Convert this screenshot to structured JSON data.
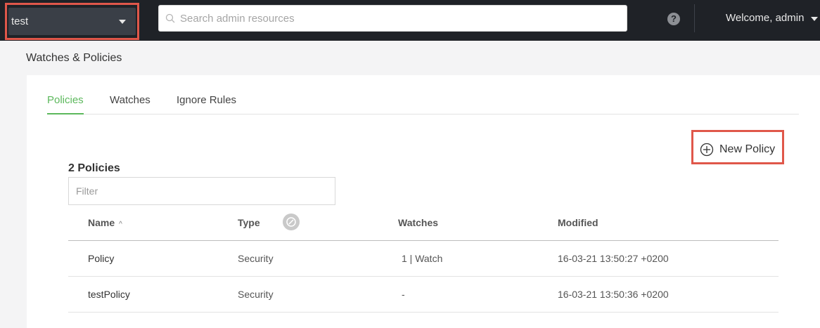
{
  "topbar": {
    "repo_selector": {
      "value": "test"
    },
    "search": {
      "placeholder": "Search admin resources",
      "value": ""
    },
    "help_label": "?",
    "welcome": "Welcome, admin"
  },
  "page": {
    "title": "Watches & Policies"
  },
  "tabs": [
    {
      "label": "Policies",
      "active": true
    },
    {
      "label": "Watches",
      "active": false
    },
    {
      "label": "Ignore Rules",
      "active": false
    }
  ],
  "new_policy_button": "New Policy",
  "policies": {
    "count_label": "2 Policies",
    "filter_placeholder": "Filter",
    "columns": [
      "Name",
      "Type",
      "Watches",
      "Modified"
    ],
    "sort_indicator": "^",
    "rows": [
      {
        "name": "Policy",
        "type": "Security",
        "watches": "1 | Watch",
        "modified": "16-03-21 13:50:27 +0200"
      },
      {
        "name": "testPolicy",
        "type": "Security",
        "watches": "-",
        "modified": "16-03-21 13:50:36 +0200"
      }
    ]
  },
  "colors": {
    "accent": "#5cb85c",
    "highlight": "#e0574a",
    "topbar": "#1f2227"
  }
}
